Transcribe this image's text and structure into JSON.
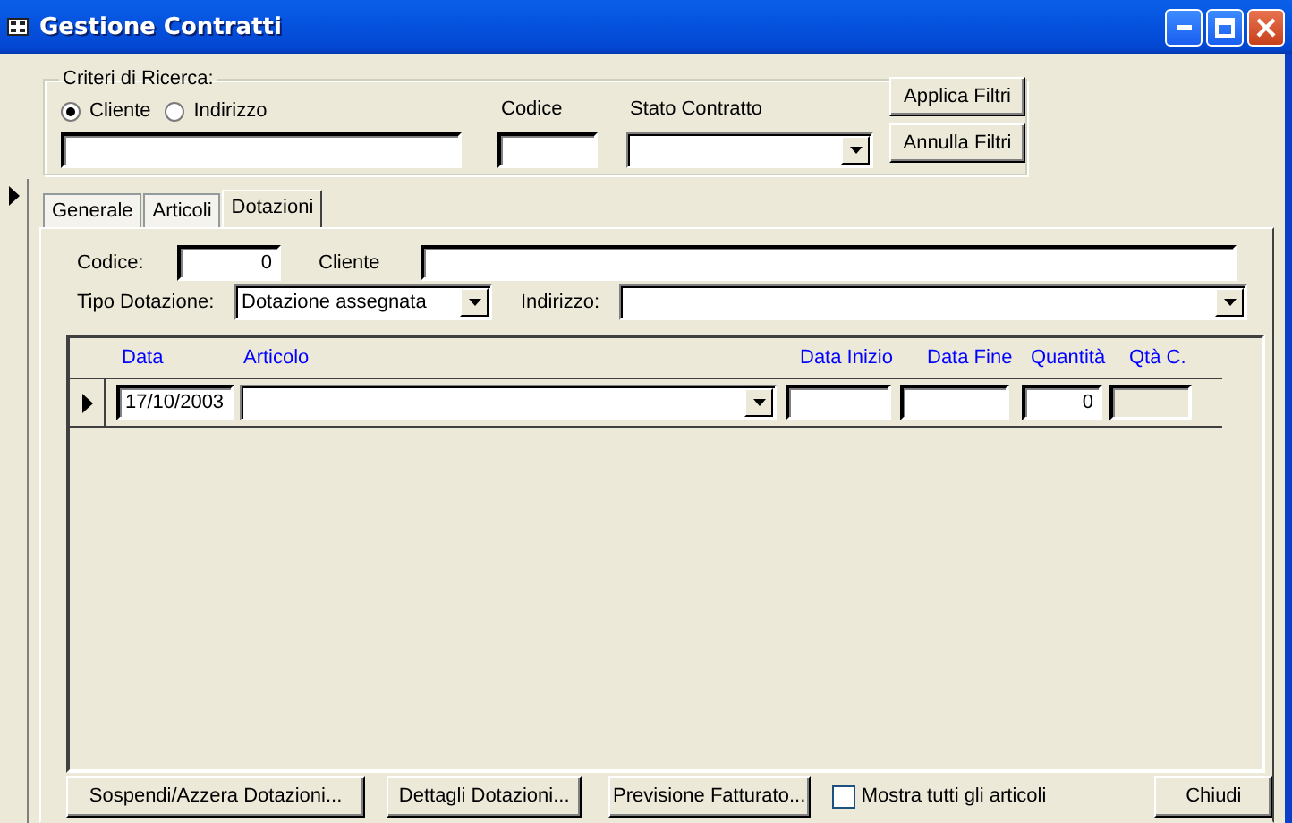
{
  "window": {
    "title": "Gestione Contratti"
  },
  "search_criteria": {
    "title": "Criteri di Ricerca:",
    "search_by": [
      {
        "label": "Cliente",
        "selected": true
      },
      {
        "label": "Indirizzo",
        "selected": false
      }
    ],
    "codice_label": "Codice",
    "stato_label": "Stato Contratto",
    "buttons": [
      "Applica Filtri",
      "Annulla Filtri"
    ]
  },
  "tabs": [
    {
      "label": "Generale",
      "selected": false
    },
    {
      "label": "Articoli",
      "selected": false
    },
    {
      "label": "Dotazioni",
      "selected": true
    }
  ],
  "details": {
    "codice_label": "Codice:",
    "codice_value": "0",
    "cliente_label": "Cliente",
    "tipo_label": "Tipo Dotazione:",
    "tipo_value": "Dotazione assegnata",
    "indirizzo_label": "Indirizzo:"
  },
  "grid": {
    "columns": [
      "Data",
      "Articolo",
      "Data Inizio",
      "Data Fine",
      "Quantità",
      "Qtà C."
    ],
    "rows": [
      {
        "current": true,
        "data": "17/10/2003",
        "quantita": "0"
      }
    ]
  },
  "footer": {
    "buttons": [
      "Sospendi/Azzera Dotazioni...",
      "Dettagli Dotazioni...",
      "Previsione Fatturato..."
    ],
    "show_all": {
      "label": "Mostra tutti gli articoli",
      "checked": false
    },
    "close_button": "Chiudi"
  }
}
